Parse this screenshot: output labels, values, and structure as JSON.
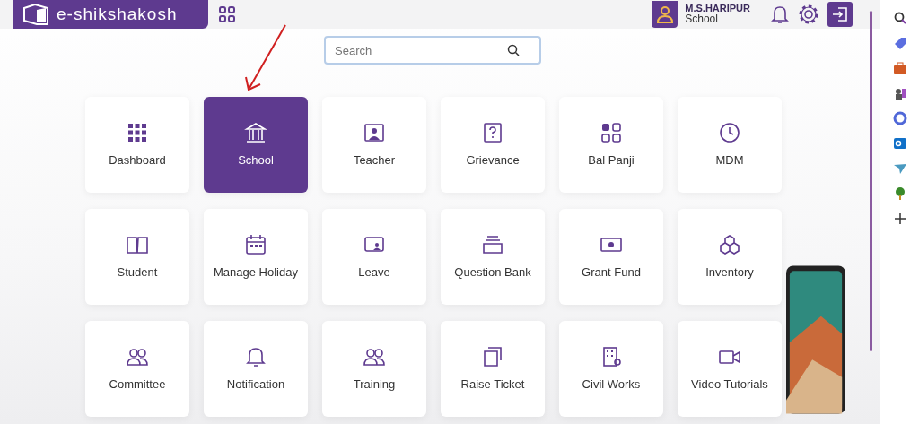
{
  "header": {
    "logo_text": "e-shikshakosh",
    "user": {
      "name": "M.S.HARIPUR",
      "role": "School"
    }
  },
  "search": {
    "placeholder": "Search"
  },
  "tiles": [
    {
      "label": "Dashboard",
      "selected": false
    },
    {
      "label": "School",
      "selected": true
    },
    {
      "label": "Teacher",
      "selected": false
    },
    {
      "label": "Grievance",
      "selected": false
    },
    {
      "label": "Bal Panji",
      "selected": false
    },
    {
      "label": "MDM",
      "selected": false
    },
    {
      "label": "Student",
      "selected": false
    },
    {
      "label": "Manage Holiday",
      "selected": false
    },
    {
      "label": "Leave",
      "selected": false
    },
    {
      "label": "Question Bank",
      "selected": false
    },
    {
      "label": "Grant Fund",
      "selected": false
    },
    {
      "label": "Inventory",
      "selected": false
    },
    {
      "label": "Committee",
      "selected": false
    },
    {
      "label": "Notification",
      "selected": false
    },
    {
      "label": "Training",
      "selected": false
    },
    {
      "label": "Raise Ticket",
      "selected": false
    },
    {
      "label": "Civil Works",
      "selected": false
    },
    {
      "label": "Video Tutorials",
      "selected": false
    }
  ]
}
